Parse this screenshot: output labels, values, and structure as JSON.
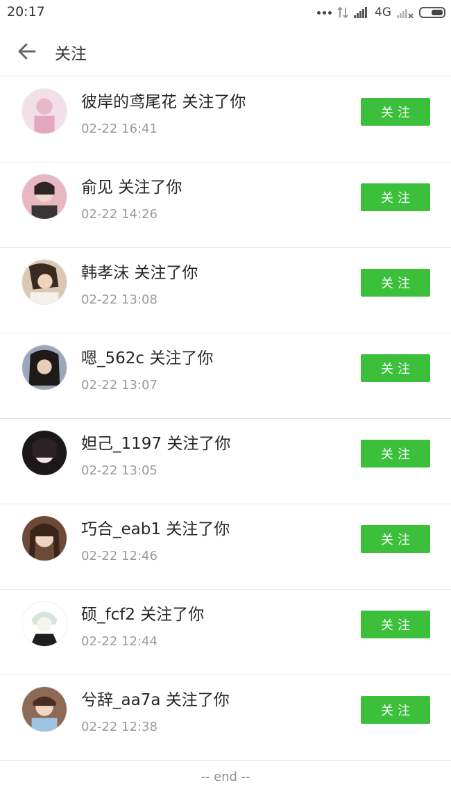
{
  "status_bar": {
    "time": "20:17",
    "network_label": "4G",
    "icons": [
      "more-dots-icon",
      "data-transfer-icon",
      "signal-icon",
      "signal-weak-icon",
      "battery-icon"
    ]
  },
  "header": {
    "title": "关注",
    "back_icon": "arrow-left-icon"
  },
  "accent_color": "#3cbf3a",
  "follows": [
    {
      "name": "彼岸的鸢尾花",
      "action": "关注了你",
      "time": "02-22 16:41",
      "button": "关注",
      "avatar_color": "#f3dfe8"
    },
    {
      "name": "俞见",
      "action": "关注了你",
      "time": "02-22 14:26",
      "button": "关注",
      "avatar_color": "#c58a93"
    },
    {
      "name": "韩孝沫",
      "action": "关注了你",
      "time": "02-22 13:08",
      "button": "关注",
      "avatar_color": "#6f5a45"
    },
    {
      "name": "嗯_562c",
      "action": "关注了你",
      "time": "02-22 13:07",
      "button": "关注",
      "avatar_color": "#4a5566"
    },
    {
      "name": "妲己_1197",
      "action": "关注了你",
      "time": "02-22 13:05",
      "button": "关注",
      "avatar_color": "#2a2326"
    },
    {
      "name": "巧合_eab1",
      "action": "关注了你",
      "time": "02-22 12:46",
      "button": "关注",
      "avatar_color": "#8b5e44"
    },
    {
      "name": "硕_fcf2",
      "action": "关注了你",
      "time": "02-22 12:44",
      "button": "关注",
      "avatar_color": "#dfe6e2"
    },
    {
      "name": "兮辞_aa7a",
      "action": "关注了你",
      "time": "02-22 12:38",
      "button": "关注",
      "avatar_color": "#b07a60"
    }
  ],
  "end_text": "-- end --"
}
